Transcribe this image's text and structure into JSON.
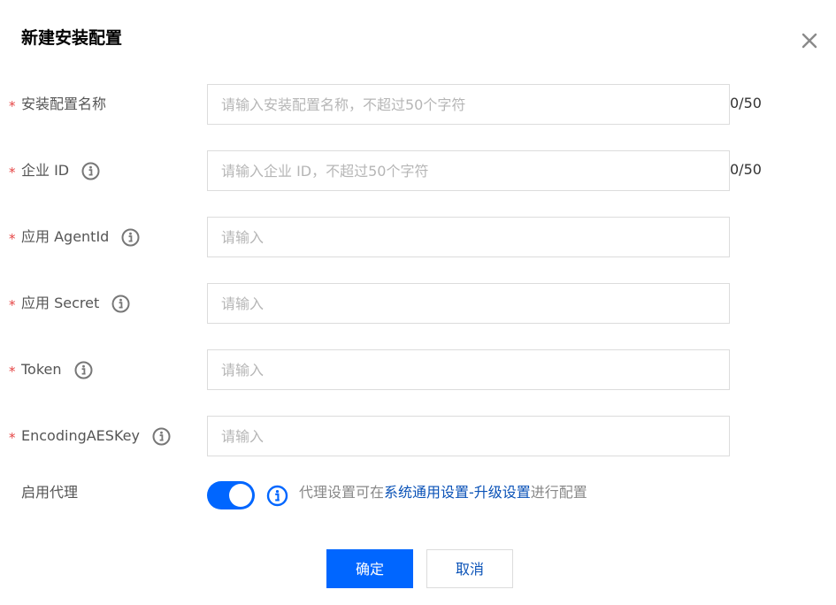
{
  "dialog": {
    "title": "新建安装配置",
    "close_icon": "close-icon"
  },
  "form": {
    "required_mark": "*",
    "fields": [
      {
        "label": "安装配置名称",
        "placeholder": "请输入安装配置名称，不超过50个字符",
        "value": "",
        "counter": "0/50",
        "has_info": false
      },
      {
        "label": "企业 ID",
        "placeholder": "请输入企业 ID，不超过50个字符",
        "value": "",
        "counter": "0/50",
        "has_info": true
      },
      {
        "label": "应用 AgentId",
        "placeholder": "请输入",
        "value": "",
        "has_info": true
      },
      {
        "label": "应用 Secret",
        "placeholder": "请输入",
        "value": "",
        "has_info": true
      },
      {
        "label": "Token",
        "placeholder": "请输入",
        "value": "",
        "has_info": true
      },
      {
        "label": "EncodingAESKey",
        "placeholder": "请输入",
        "value": "",
        "has_info": true
      }
    ],
    "proxy": {
      "label": "启用代理",
      "enabled": true,
      "hint_prefix": "代理设置可在",
      "hint_link": "系统通用设置-升级设置",
      "hint_suffix": "进行配置"
    }
  },
  "footer": {
    "confirm_label": "确定",
    "cancel_label": "取消"
  },
  "colors": {
    "primary": "#0066ff",
    "link": "#0a52b7",
    "required": "#e54545",
    "label": "#555555",
    "placeholder": "#b6b6b6",
    "border": "#dcdcdc"
  }
}
